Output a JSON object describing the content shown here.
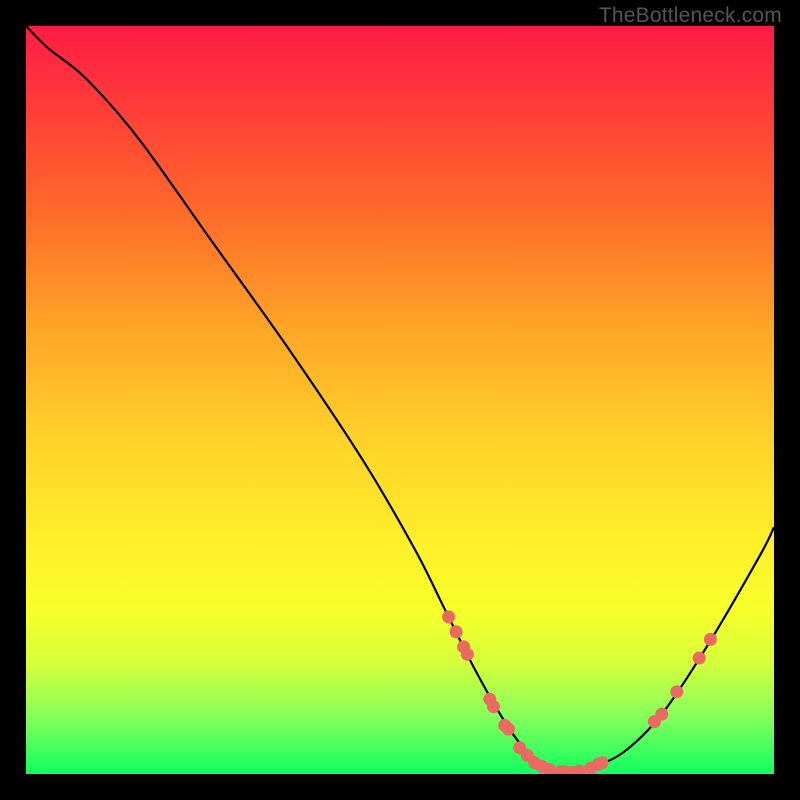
{
  "watermark": "TheBottleneck.com",
  "chart_data": {
    "type": "line",
    "title": "",
    "xlabel": "",
    "ylabel": "",
    "xlim": [
      0,
      100
    ],
    "ylim": [
      0,
      100
    ],
    "series": [
      {
        "name": "curve",
        "x": [
          0,
          3,
          8,
          15,
          25,
          35,
          45,
          52,
          56,
          60,
          64,
          67,
          70,
          73,
          76,
          80,
          85,
          91,
          98,
          100
        ],
        "y": [
          100,
          97,
          93,
          85,
          71,
          57,
          42,
          30,
          22,
          14,
          7,
          3,
          1,
          0,
          1,
          3,
          8,
          17,
          29,
          33
        ]
      }
    ],
    "points": [
      {
        "x": 56.5,
        "y": 21
      },
      {
        "x": 57.5,
        "y": 19
      },
      {
        "x": 58.5,
        "y": 17
      },
      {
        "x": 59,
        "y": 16
      },
      {
        "x": 62,
        "y": 10
      },
      {
        "x": 62.5,
        "y": 9
      },
      {
        "x": 64,
        "y": 6.5
      },
      {
        "x": 64.5,
        "y": 6
      },
      {
        "x": 66,
        "y": 3.5
      },
      {
        "x": 67,
        "y": 2.5
      },
      {
        "x": 68,
        "y": 1.5
      },
      {
        "x": 69,
        "y": 1
      },
      {
        "x": 70,
        "y": 0.6
      },
      {
        "x": 71.5,
        "y": 0.3
      },
      {
        "x": 72,
        "y": 0.3
      },
      {
        "x": 73,
        "y": 0.2
      },
      {
        "x": 74,
        "y": 0.4
      },
      {
        "x": 75.5,
        "y": 0.8
      },
      {
        "x": 76.5,
        "y": 1.3
      },
      {
        "x": 77,
        "y": 1.5
      },
      {
        "x": 84,
        "y": 7
      },
      {
        "x": 85,
        "y": 8
      },
      {
        "x": 87,
        "y": 11
      },
      {
        "x": 90,
        "y": 15.5
      },
      {
        "x": 91.5,
        "y": 18
      }
    ],
    "gradient_colors": {
      "top": "#ff1b46",
      "mid_upper": "#ffa427",
      "mid": "#fff12a",
      "mid_lower": "#d6ff3a",
      "bottom": "#0fff60"
    },
    "curve_color": "#000000",
    "point_color": "#ea6a62"
  }
}
